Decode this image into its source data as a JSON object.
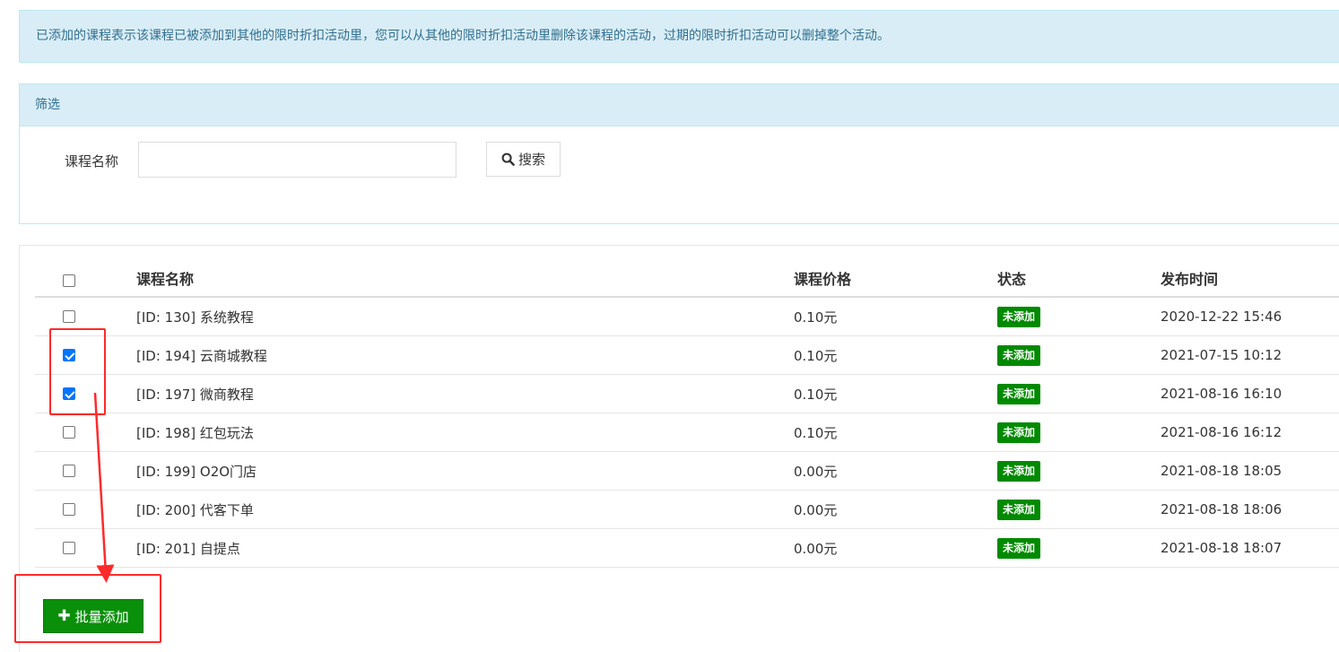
{
  "notice": {
    "text": "已添加的课程表示该课程已被添加到其他的限时折扣活动里，您可以从其他的限时折扣活动里删除该课程的活动，过期的限时折扣活动可以删掉整个活动。"
  },
  "filter": {
    "heading": "筛选",
    "name_label": "课程名称",
    "name_value": "",
    "search_button": "搜索",
    "search_icon": "search-icon"
  },
  "table": {
    "columns": {
      "name": "课程名称",
      "price": "课程价格",
      "status": "状态",
      "time": "发布时间"
    },
    "header_checked": false,
    "rows": [
      {
        "checked": false,
        "name": "[ID: 130] 系统教程",
        "price": "0.10元",
        "status": "未添加",
        "time": "2020-12-22 15:46"
      },
      {
        "checked": true,
        "name": "[ID: 194] 云商城教程",
        "price": "0.10元",
        "status": "未添加",
        "time": "2021-07-15 10:12"
      },
      {
        "checked": true,
        "name": "[ID: 197] 微商教程",
        "price": "0.10元",
        "status": "未添加",
        "time": "2021-08-16 16:10"
      },
      {
        "checked": false,
        "name": "[ID: 198] 红包玩法",
        "price": "0.10元",
        "status": "未添加",
        "time": "2021-08-16 16:12"
      },
      {
        "checked": false,
        "name": "[ID: 199] O2O门店",
        "price": "0.00元",
        "status": "未添加",
        "time": "2021-08-18 18:05"
      },
      {
        "checked": false,
        "name": "[ID: 200] 代客下单",
        "price": "0.00元",
        "status": "未添加",
        "time": "2021-08-18 18:06"
      },
      {
        "checked": false,
        "name": "[ID: 201] 自提点",
        "price": "0.00元",
        "status": "未添加",
        "time": "2021-08-18 18:07"
      }
    ]
  },
  "batch_add": {
    "label": "批量添加",
    "icon": "plus-icon"
  },
  "colors": {
    "info_bg": "#d9edf7",
    "info_text": "#31708f",
    "success": "#008a00",
    "checkbox_on": "#0075ff",
    "annotation": "#ff2a2a"
  }
}
